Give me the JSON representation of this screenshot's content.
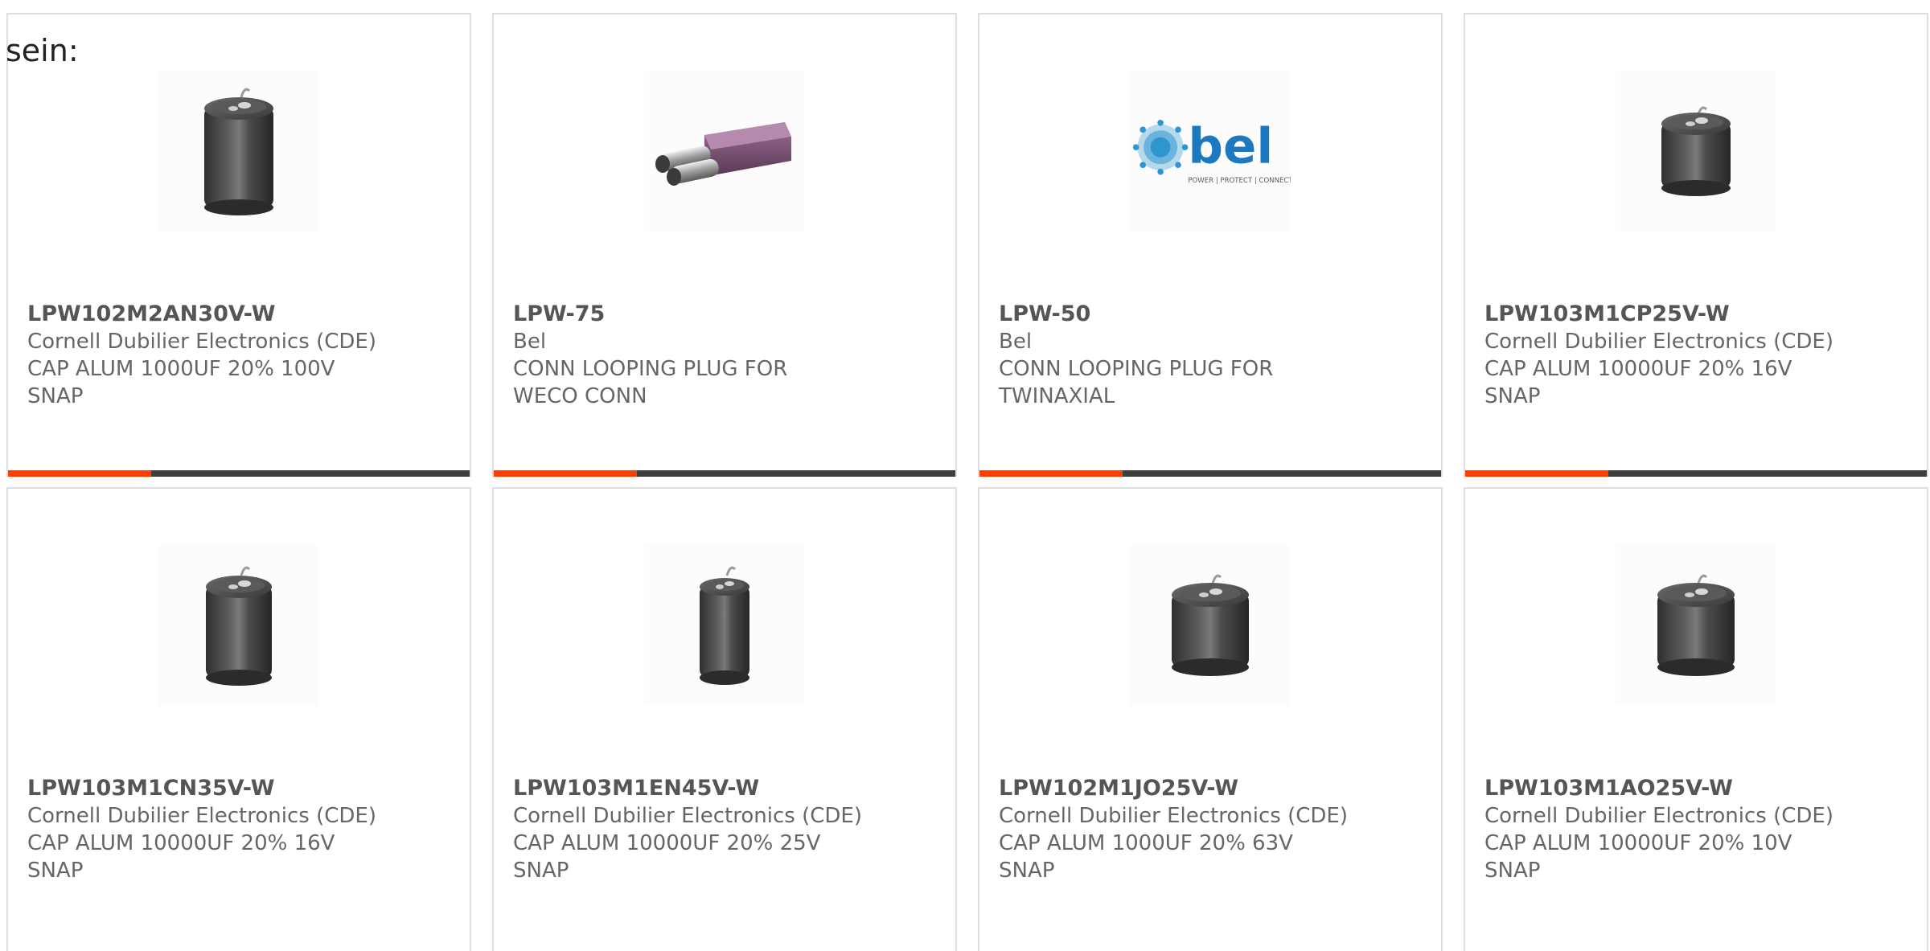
{
  "intro_text": "sein:",
  "colors": {
    "accent_fill": "#ff3f00",
    "accent_track": "#3e3e3e",
    "card_border": "#dedede"
  },
  "cards": [
    {
      "part_number": "LPW102M2AN30V-W",
      "manufacturer": "Cornell Dubilier Electronics (CDE)",
      "description": "CAP ALUM 1000UF 20% 100V SNAP",
      "image_icon": "capacitor-image",
      "accent_progress": 0.31
    },
    {
      "part_number": "LPW-75",
      "manufacturer": "Bel",
      "description": "CONN LOOPING PLUG FOR WECO CONN",
      "image_icon": "looping-plug-image",
      "accent_progress": 0.31
    },
    {
      "part_number": "LPW-50",
      "manufacturer": "Bel",
      "description": "CONN LOOPING PLUG FOR TWINAXIAL",
      "image_icon": "bel-logo",
      "logo_text": "bel",
      "logo_tagline": "POWER | PROTECT | CONNECT",
      "accent_progress": 0.31
    },
    {
      "part_number": "LPW103M1CP25V-W",
      "manufacturer": "Cornell Dubilier Electronics (CDE)",
      "description": "CAP ALUM 10000UF 20% 16V SNAP",
      "image_icon": "capacitor-image",
      "accent_progress": 0.31
    },
    {
      "part_number": "LPW103M1CN35V-W",
      "manufacturer": "Cornell Dubilier Electronics (CDE)",
      "description": "CAP ALUM 10000UF 20% 16V SNAP",
      "image_icon": "capacitor-image"
    },
    {
      "part_number": "LPW103M1EN45V-W",
      "manufacturer": "Cornell Dubilier Electronics (CDE)",
      "description": "CAP ALUM 10000UF 20% 25V SNAP",
      "image_icon": "capacitor-image"
    },
    {
      "part_number": "LPW102M1JO25V-W",
      "manufacturer": "Cornell Dubilier Electronics (CDE)",
      "description": "CAP ALUM 1000UF 20% 63V SNAP",
      "image_icon": "capacitor-image"
    },
    {
      "part_number": "LPW103M1AO25V-W",
      "manufacturer": "Cornell Dubilier Electronics (CDE)",
      "description": "CAP ALUM 10000UF 20% 10V SNAP",
      "image_icon": "capacitor-image"
    }
  ]
}
